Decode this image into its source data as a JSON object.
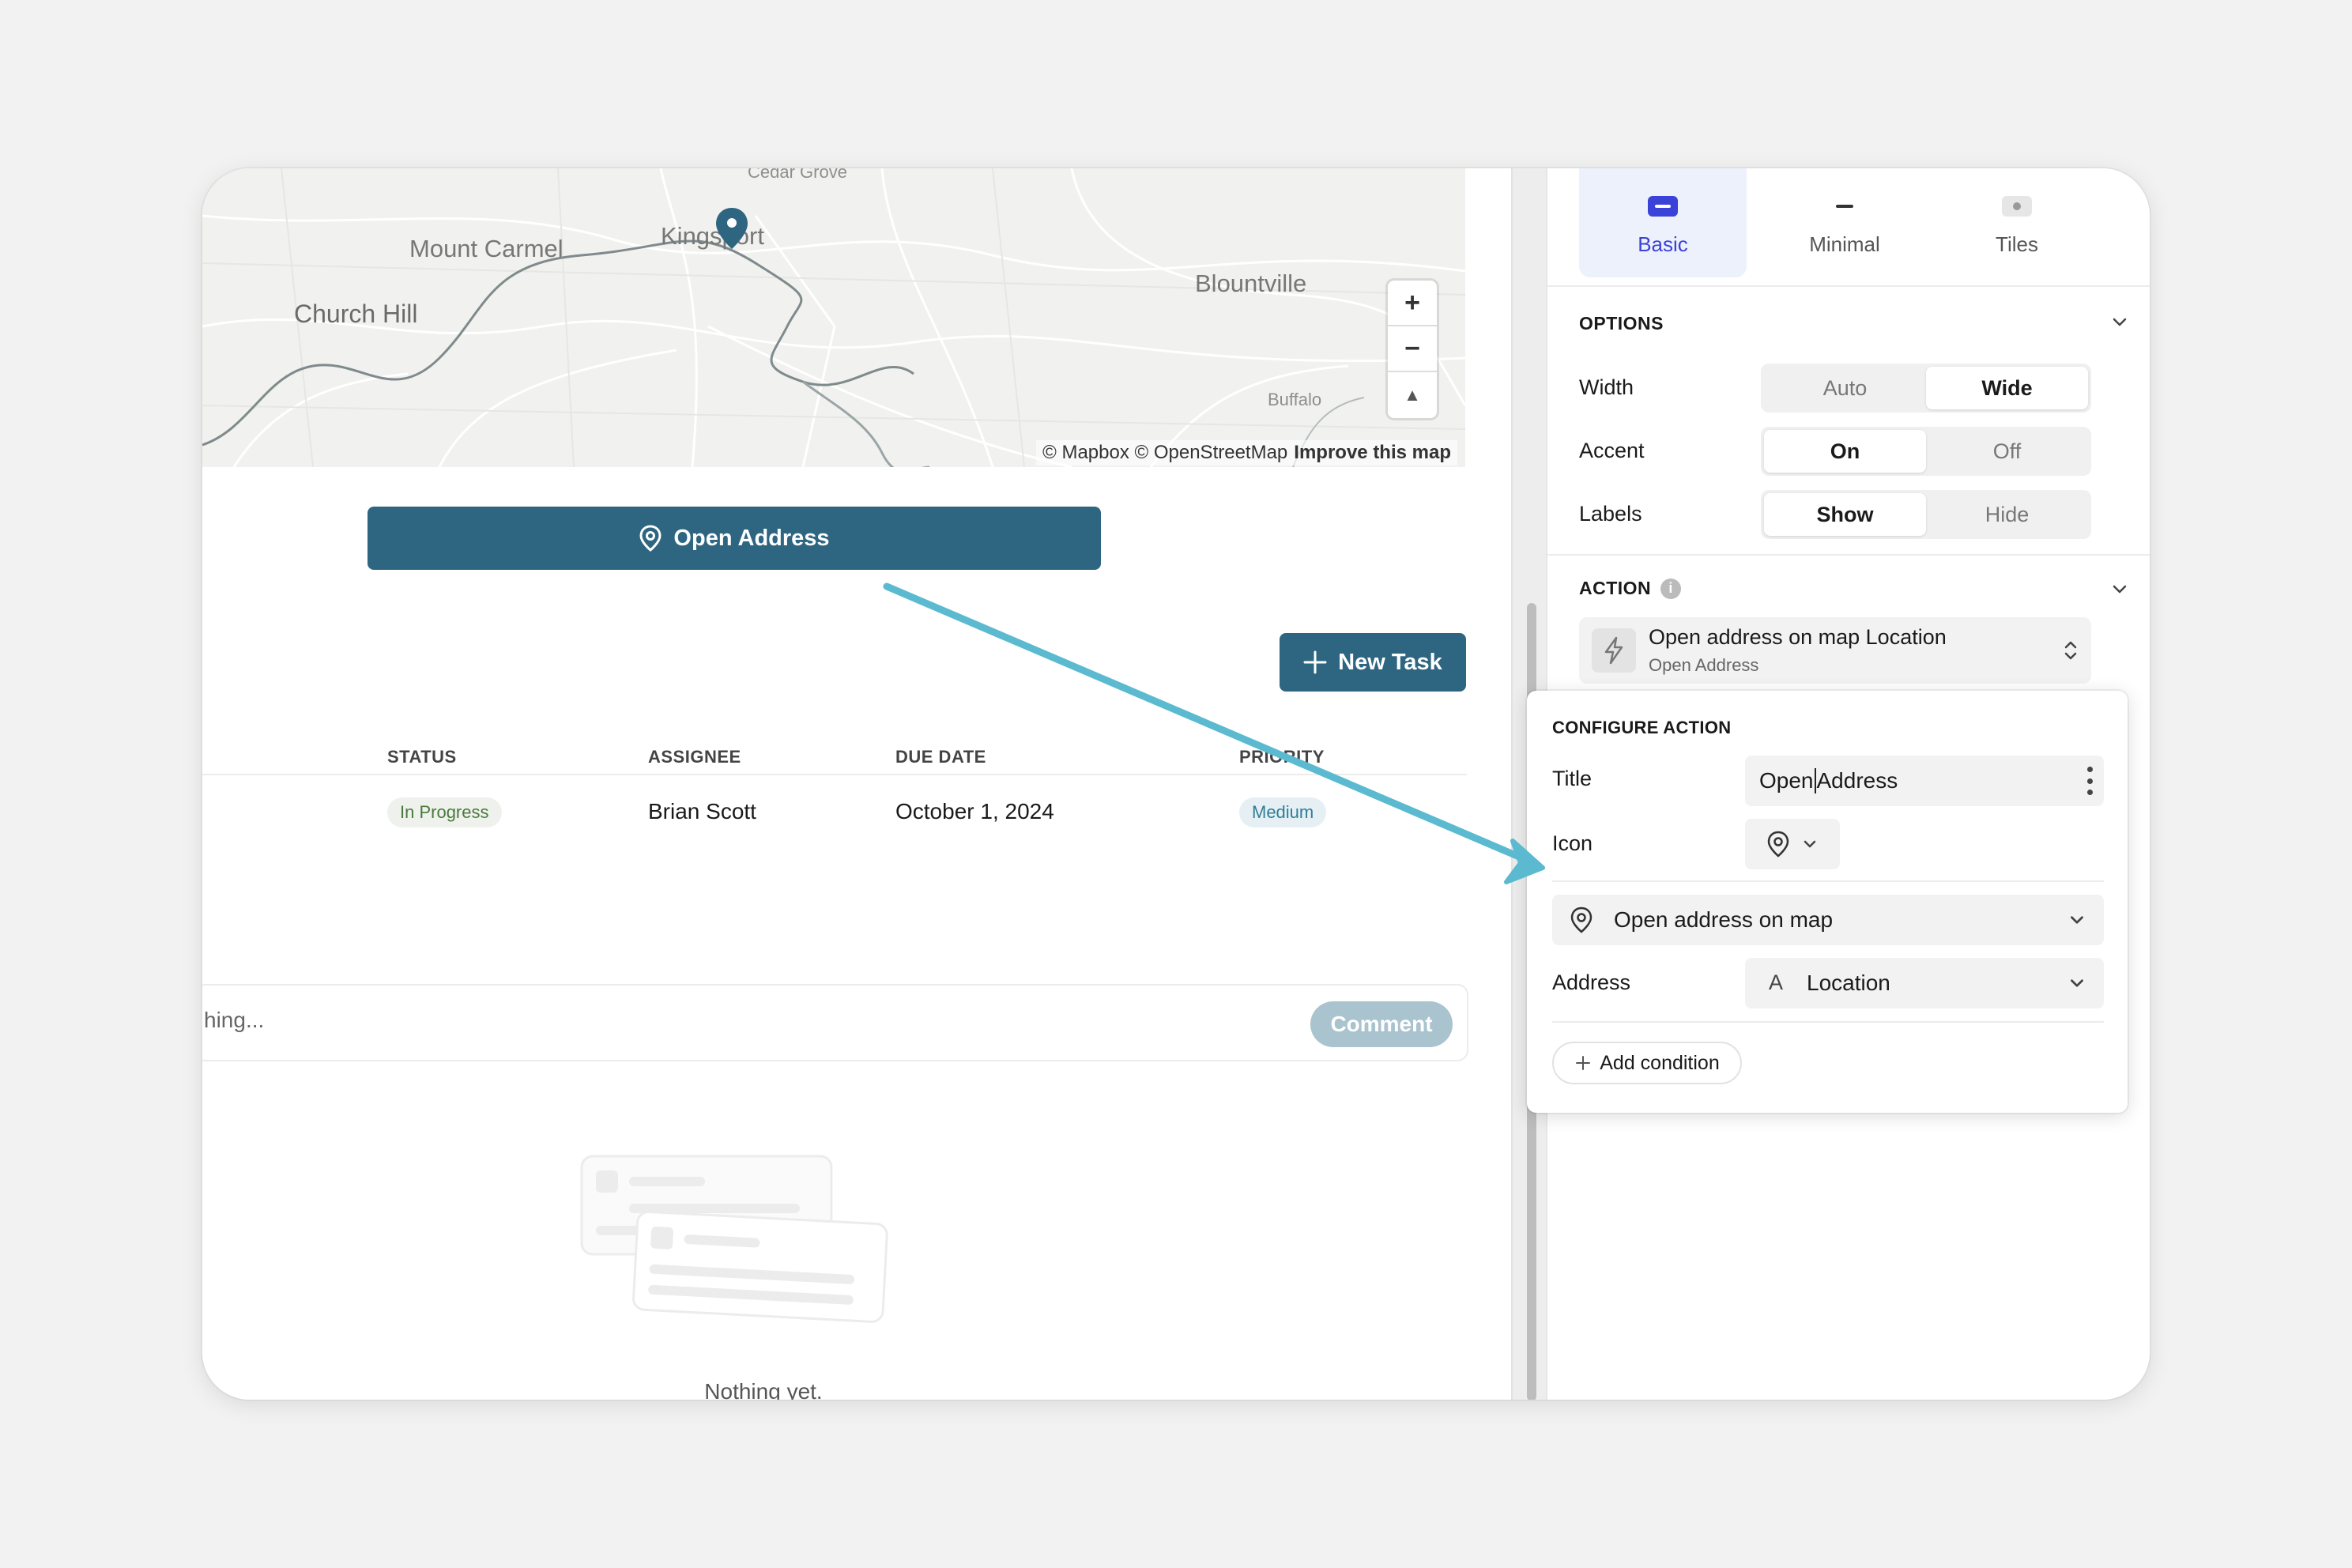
{
  "map": {
    "labels": {
      "cedar_grove": "Cedar Grove",
      "mount_carmel": "Mount Carmel",
      "kingsport": "Kingsport",
      "church_hill": "Church Hill",
      "blountville": "Blountville",
      "buffalo": "Buffalo"
    },
    "zoom_in": "+",
    "zoom_out": "−",
    "compass": "▲",
    "attribution": "© Mapbox © OpenStreetMap",
    "improve_link": "Improve this map"
  },
  "open_address_button": "Open Address",
  "new_task_button": "New Task",
  "table": {
    "headers": {
      "status": "STATUS",
      "assignee": "ASSIGNEE",
      "due_date": "DUE DATE",
      "priority": "PRIORITY"
    },
    "row": {
      "status": "In Progress",
      "assignee": "Brian Scott",
      "due_date": "October 1, 2024",
      "priority": "Medium"
    }
  },
  "comment": {
    "placeholder": "hing...",
    "button": "Comment"
  },
  "empty_state": "Nothing yet.",
  "panel": {
    "tabs": [
      {
        "label": "Basic",
        "icon": "basic-style-icon"
      },
      {
        "label": "Minimal",
        "icon": "minimal-style-icon"
      },
      {
        "label": "Tiles",
        "icon": "tiles-style-icon"
      }
    ],
    "options_title": "OPTIONS",
    "width_label": "Width",
    "width_options": [
      "Auto",
      "Wide"
    ],
    "accent_label": "Accent",
    "accent_options": [
      "On",
      "Off"
    ],
    "labels_label": "Labels",
    "labels_options": [
      "Show",
      "Hide"
    ],
    "action_title": "ACTION",
    "action_main": "Open address on map Location",
    "action_sub": "Open Address"
  },
  "configure": {
    "title": "CONFIGURE ACTION",
    "title_label": "Title",
    "title_value_before": "Open",
    "title_value_after": "Address",
    "icon_label": "Icon",
    "action_type": "Open address on map",
    "address_label": "Address",
    "address_type_glyph": "A",
    "address_value": "Location",
    "add_condition": "Add condition"
  },
  "colors": {
    "primary": "#2e6581",
    "arrow": "#5bbad0",
    "tab_active": "#3b42d8"
  }
}
